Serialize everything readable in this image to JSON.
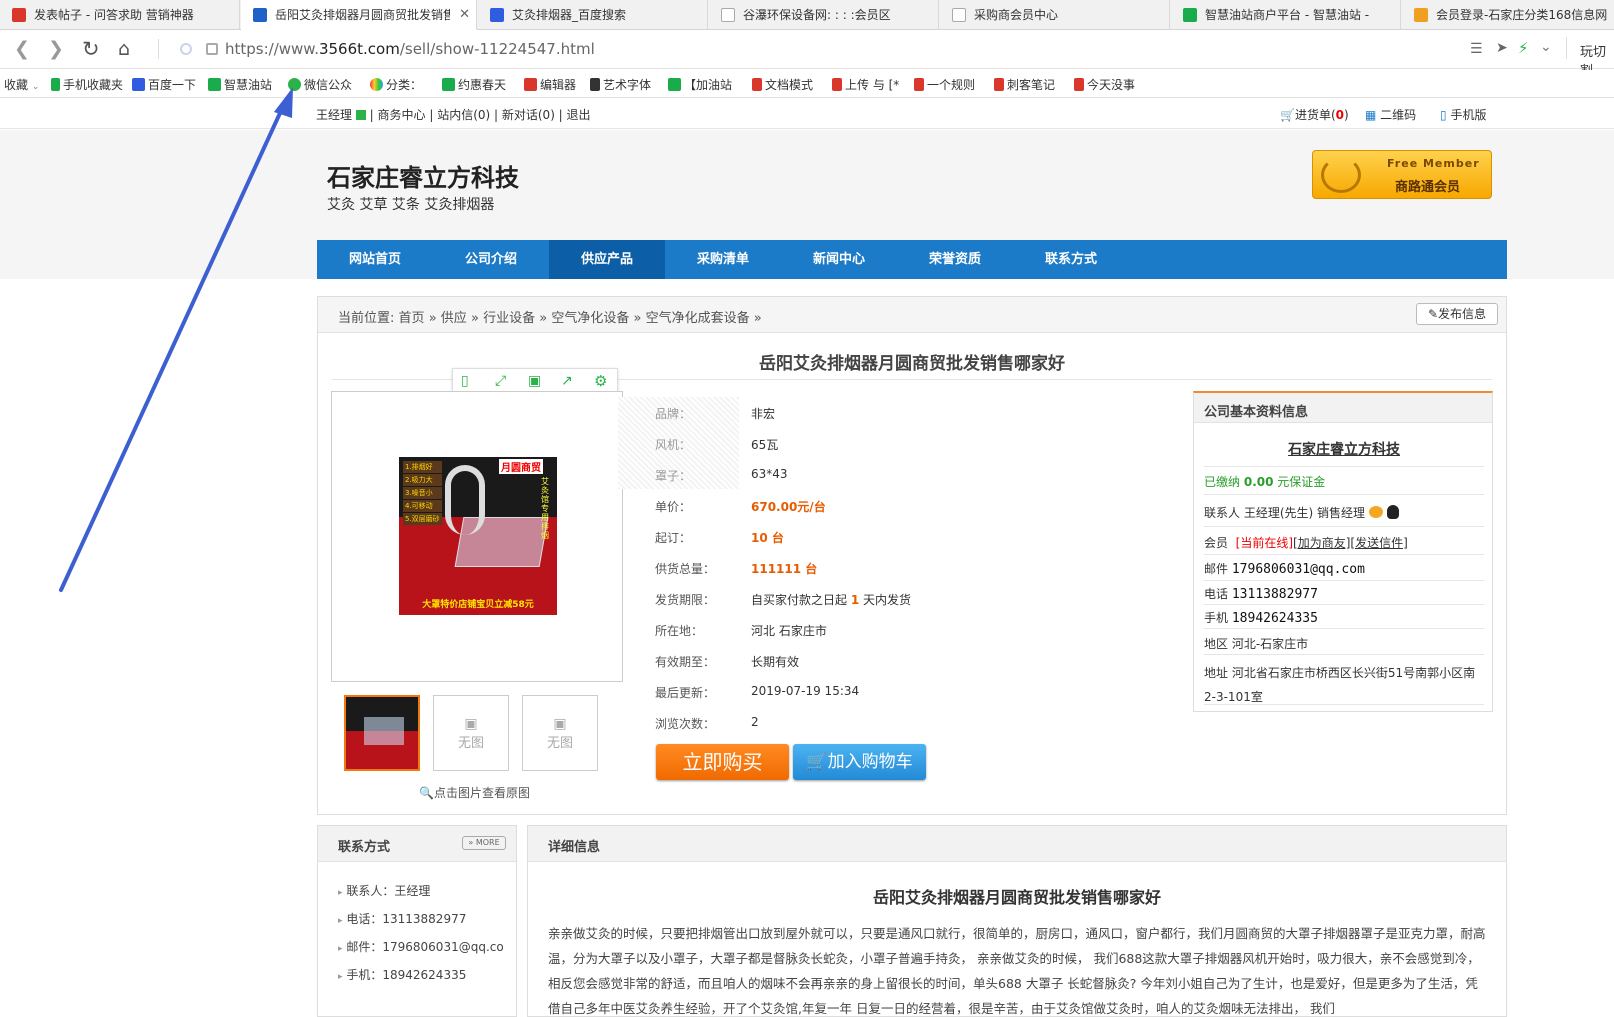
{
  "tabs": [
    {
      "label": "发表帖子 - 问答求助 营销神器",
      "icon_color": "#d9372c"
    },
    {
      "label": "岳阳艾灸排烟器月圆商贸批发销售哪家好",
      "icon_color": "#1e62c8"
    },
    {
      "label": "艾灸排烟器_百度搜索",
      "icon_color": "#2f5ce0"
    },
    {
      "label": "谷瀑环保设备网: : : :会员区",
      "icon_color": "#ffffff"
    },
    {
      "label": "采购商会员中心",
      "icon_color": "#ffffff"
    },
    {
      "label": "智慧油站商户平台 - 智慧油站 -",
      "icon_color": "#1aab4a"
    },
    {
      "label": "会员登录-石家庄分类168信息网",
      "icon_color": "#f0a020"
    }
  ],
  "address": {
    "prefix": "https://www.",
    "domain": "3566t.com",
    "path": "/sell/show-11224547.html",
    "right_text": "玩切割"
  },
  "bookmarks": [
    "收藏",
    "手机收藏夹",
    "百度一下",
    "智慧油站",
    "微信公众",
    "分类：",
    "约惠春天",
    "编辑器",
    "艺术字体",
    "【加油站",
    "文档模式",
    "上传 与 [*",
    "一个规则",
    "刺客笔记",
    "今天没事"
  ],
  "topline": {
    "user": "王经理",
    "links": "| 商务中心 | 站内信(0) | 新对话(0) | 退出",
    "cart_label": "进货单(",
    "cart_count": "0",
    "cart_close": ")",
    "qrcode": "二维码",
    "mobile": "手机版"
  },
  "header": {
    "company": "石家庄睿立方科技",
    "slogan": "艾灸 艾草 艾条 艾灸排烟器",
    "badge_top": "Free Member",
    "badge_bottom": "商路通会员"
  },
  "nav": [
    "网站首页",
    "公司介绍",
    "供应产品",
    "采购清单",
    "新闻中心",
    "荣誉资质",
    "联系方式"
  ],
  "breadcrumb": {
    "label": "当前位置:",
    "items": [
      "首页",
      "供应",
      "行业设备",
      "空气净化设备",
      "空气净化成套设备"
    ],
    "sep": "»",
    "post_button": "发布信息"
  },
  "product": {
    "title": "岳阳艾灸排烟器月圆商贸批发销售哪家好",
    "specs": [
      {
        "label": "品牌：",
        "value": "非宏"
      },
      {
        "label": "风机：",
        "value": "65瓦"
      },
      {
        "label": "罩子：",
        "value": "63*43"
      }
    ],
    "price_label": "单价：",
    "price": "670.00元/台",
    "moq_label": "起订：",
    "moq": "10 台",
    "supply_label": "供货总量：",
    "supply": "111111 台",
    "ship_label": "发货期限：",
    "ship_prefix": "自买家付款之日起 ",
    "ship_days": "1",
    "ship_suffix": " 天内发货",
    "loc_label": "所在地：",
    "loc": "河北 石家庄市",
    "valid_label": "有效期至：",
    "valid": "长期有效",
    "update_label": "最后更新：",
    "update": "2019-07-19 15:34",
    "views_label": "浏览次数：",
    "views": "2",
    "buy_button": "立即购买",
    "cart_button": "加入购物车",
    "no_image": "无图",
    "zoom_hint": "点击图片查看原图",
    "image_lines": [
      "1.排烟好",
      "2.吸力大",
      "3.噪音小",
      "4.可移动",
      "5.双层磨砂"
    ],
    "image_brand": "月圆商贸",
    "image_side": "艾灸馆专用排烟",
    "image_bottom": "大罩特价店铺宝贝立减58元"
  },
  "company_info": {
    "title": "公司基本资料信息",
    "name": "石家庄睿立方科技",
    "deposit_label": "已缴纳",
    "deposit_amount": "0.00",
    "deposit_unit": "元保证金",
    "contact_label": "联系人",
    "contact": "王经理(先生) 销售经理",
    "member_label": "会员",
    "member_online": "[当前在线]",
    "member_friend": "[加为商友]",
    "member_msg": "[发送信件]",
    "email_label": "邮件",
    "email": "1796806031@qq.com",
    "phone_label": "电话",
    "phone": "13113882977",
    "mobile_label": "手机",
    "mobile": "18942624335",
    "area_label": "地区",
    "area": "河北-石家庄市",
    "addr_label": "地址",
    "addr": "河北省石家庄市桥西区长兴街51号南郭小区南2-3-101室"
  },
  "contact_box": {
    "title": "联系方式",
    "more": "MORE",
    "items": [
      "联系人：王经理",
      "电话：13113882977",
      "邮件：1796806031@qq.co",
      "手机：18942624335"
    ]
  },
  "detail": {
    "title": "详细信息",
    "heading": "岳阳艾灸排烟器月圆商贸批发销售哪家好",
    "body": "亲亲做艾灸的时候，只要把排烟管出口放到屋外就可以，只要是通风口就行，很简单的，厨房口，通风口，窗户都行，我们月圆商贸的大罩子排烟器罩子是亚克力罩，耐高温，分为大罩子以及小罩子，大罩子都是督脉灸长蛇灸，小罩子普遍手持灸， 亲亲做艾灸的时候， 我们688这款大罩子排烟器风机开始时，吸力很大，亲不会感觉到冷，相反您会感觉非常的舒适，而且咱人的烟味不会再亲亲的身上留很长的时间，单头688 大罩子 长蛇督脉灸? 今年刘小姐自己为了生计，也是爱好，但是更多为了生活，凭借自己多年中医艾灸养生经验，开了个艾灸馆,年复一年 日复一日的经营着，很是辛苦，由于艾灸馆做艾灸时，咱人的艾灸烟味无法排出， 我们"
  },
  "colors": {
    "nav": "#1b7bc9",
    "nav_active": "#0c5fa6",
    "price": "#e65c00",
    "buy": "#f07a10",
    "cart": "#2d97e0",
    "accent_line": "#f08c30",
    "annotation_arrow": "#3c5fd1"
  }
}
